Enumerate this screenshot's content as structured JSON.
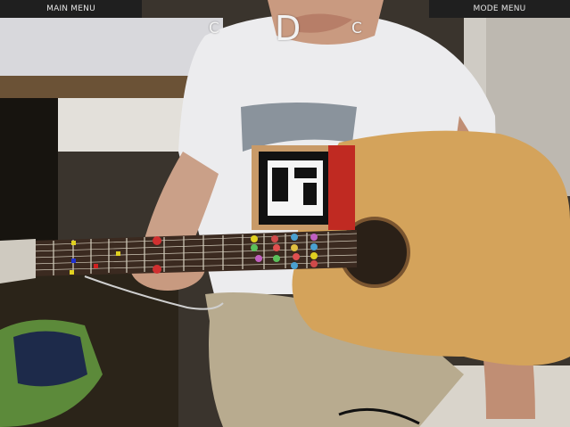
{
  "menu": {
    "main_label": "MAIN MENU",
    "mode_label": "MODE MENU"
  },
  "chords": {
    "previous": "C",
    "current": "D",
    "next": "C"
  },
  "colors": {
    "menu_bg": "#1f1f1f",
    "menu_text": "#e6e6e6",
    "chord_text": "#f2f2f2"
  }
}
